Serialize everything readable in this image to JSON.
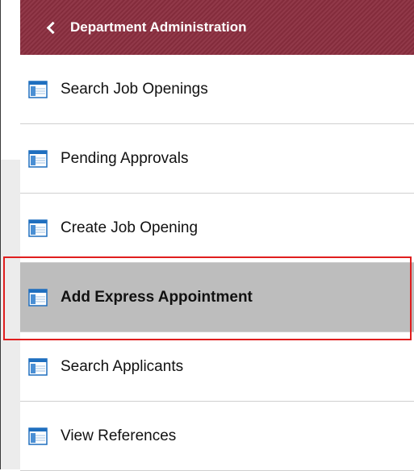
{
  "header": {
    "title": "Department Administration"
  },
  "menu": {
    "items": [
      {
        "label": "Search Job Openings",
        "icon": "table-window-icon",
        "selected": false
      },
      {
        "label": "Pending Approvals",
        "icon": "table-window-icon",
        "selected": false
      },
      {
        "label": "Create Job Opening",
        "icon": "table-window-icon",
        "selected": false
      },
      {
        "label": "Add Express Appointment",
        "icon": "table-window-icon",
        "selected": true
      },
      {
        "label": "Search Applicants",
        "icon": "table-window-icon",
        "selected": false
      },
      {
        "label": "View References",
        "icon": "table-window-icon",
        "selected": false
      }
    ]
  },
  "colors": {
    "header_bg": "#8b2e3f",
    "selected_bg": "#bdbdbd",
    "highlight_border": "#e01e1e",
    "icon_blue": "#1f6fbf"
  }
}
